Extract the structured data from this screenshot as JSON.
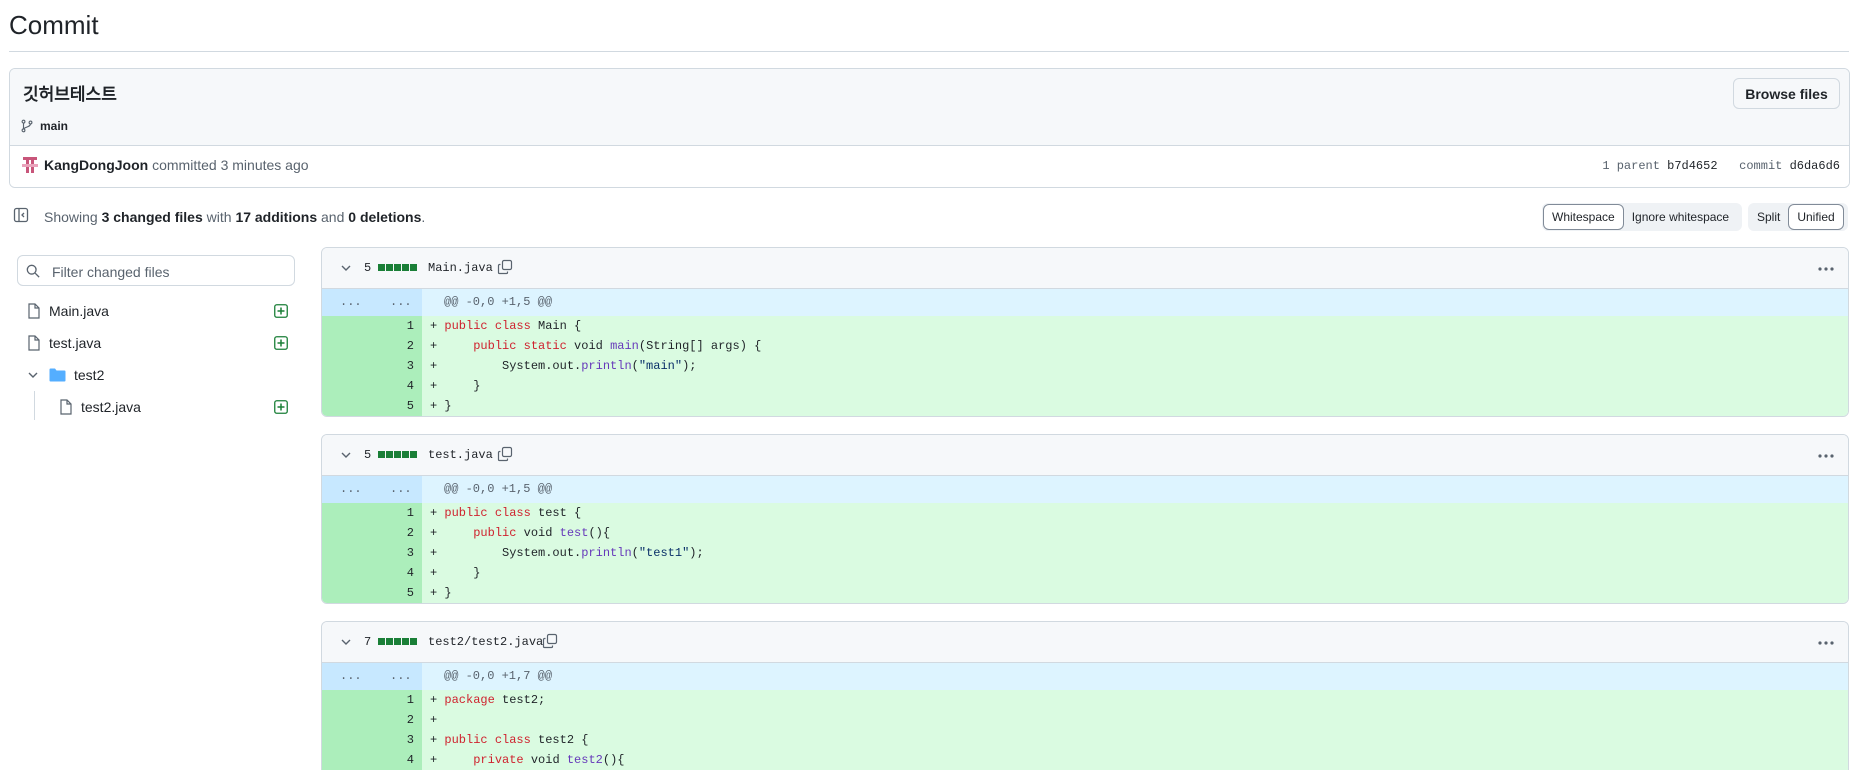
{
  "page": {
    "title": "Commit"
  },
  "commit": {
    "message": "깃허브테스트",
    "browse_label": "Browse files",
    "branch": "main",
    "author": "KangDongJoon",
    "action": "committed",
    "time": "3 minutes ago",
    "parent_label": "1 parent",
    "parent_sha": "b7d4652",
    "commit_label": "commit",
    "commit_sha": "d6da6d6"
  },
  "summary": {
    "prefix": "Showing",
    "changed": "3 changed files",
    "with": "with",
    "additions": "17 additions",
    "and": "and",
    "deletions": "0 deletions",
    "suffix": "."
  },
  "toolbar": {
    "whitespace": "Whitespace",
    "ignore_whitespace": "Ignore whitespace",
    "split": "Split",
    "unified": "Unified"
  },
  "filter": {
    "placeholder": "Filter changed files"
  },
  "tree": [
    {
      "name": "Main.java",
      "type": "file",
      "added": true
    },
    {
      "name": "test.java",
      "type": "file",
      "added": true
    },
    {
      "name": "test2",
      "type": "folder"
    },
    {
      "name": "test2.java",
      "type": "file",
      "added": true
    }
  ],
  "files": [
    {
      "count": "5",
      "path": "Main.java",
      "hunk": {
        "d1": "...",
        "d2": "...",
        "text": "@@ -0,0 +1,5 @@"
      },
      "lines": [
        {
          "n": "1",
          "code": "+ public class Main {"
        },
        {
          "n": "2",
          "code": "+     public static void main(String[] args) {"
        },
        {
          "n": "3",
          "code": "+         System.out.println(\"main\");"
        },
        {
          "n": "4",
          "code": "+     }"
        },
        {
          "n": "5",
          "code": "+ }"
        }
      ]
    },
    {
      "count": "5",
      "path": "test.java",
      "hunk": {
        "d1": "...",
        "d2": "...",
        "text": "@@ -0,0 +1,5 @@"
      },
      "lines": [
        {
          "n": "1",
          "code": "+ public class test {"
        },
        {
          "n": "2",
          "code": "+     public void test(){"
        },
        {
          "n": "3",
          "code": "+         System.out.println(\"test1\");"
        },
        {
          "n": "4",
          "code": "+     }"
        },
        {
          "n": "5",
          "code": "+ }"
        }
      ]
    },
    {
      "count": "7",
      "path": "test2/test2.java",
      "hunk": {
        "d1": "...",
        "d2": "...",
        "text": "@@ -0,0 +1,7 @@"
      },
      "lines": [
        {
          "n": "1",
          "code": "+ package test2;"
        },
        {
          "n": "2",
          "code": "+"
        },
        {
          "n": "3",
          "code": "+ public class test2 {"
        },
        {
          "n": "4",
          "code": "+     private void test2(){"
        }
      ]
    }
  ]
}
